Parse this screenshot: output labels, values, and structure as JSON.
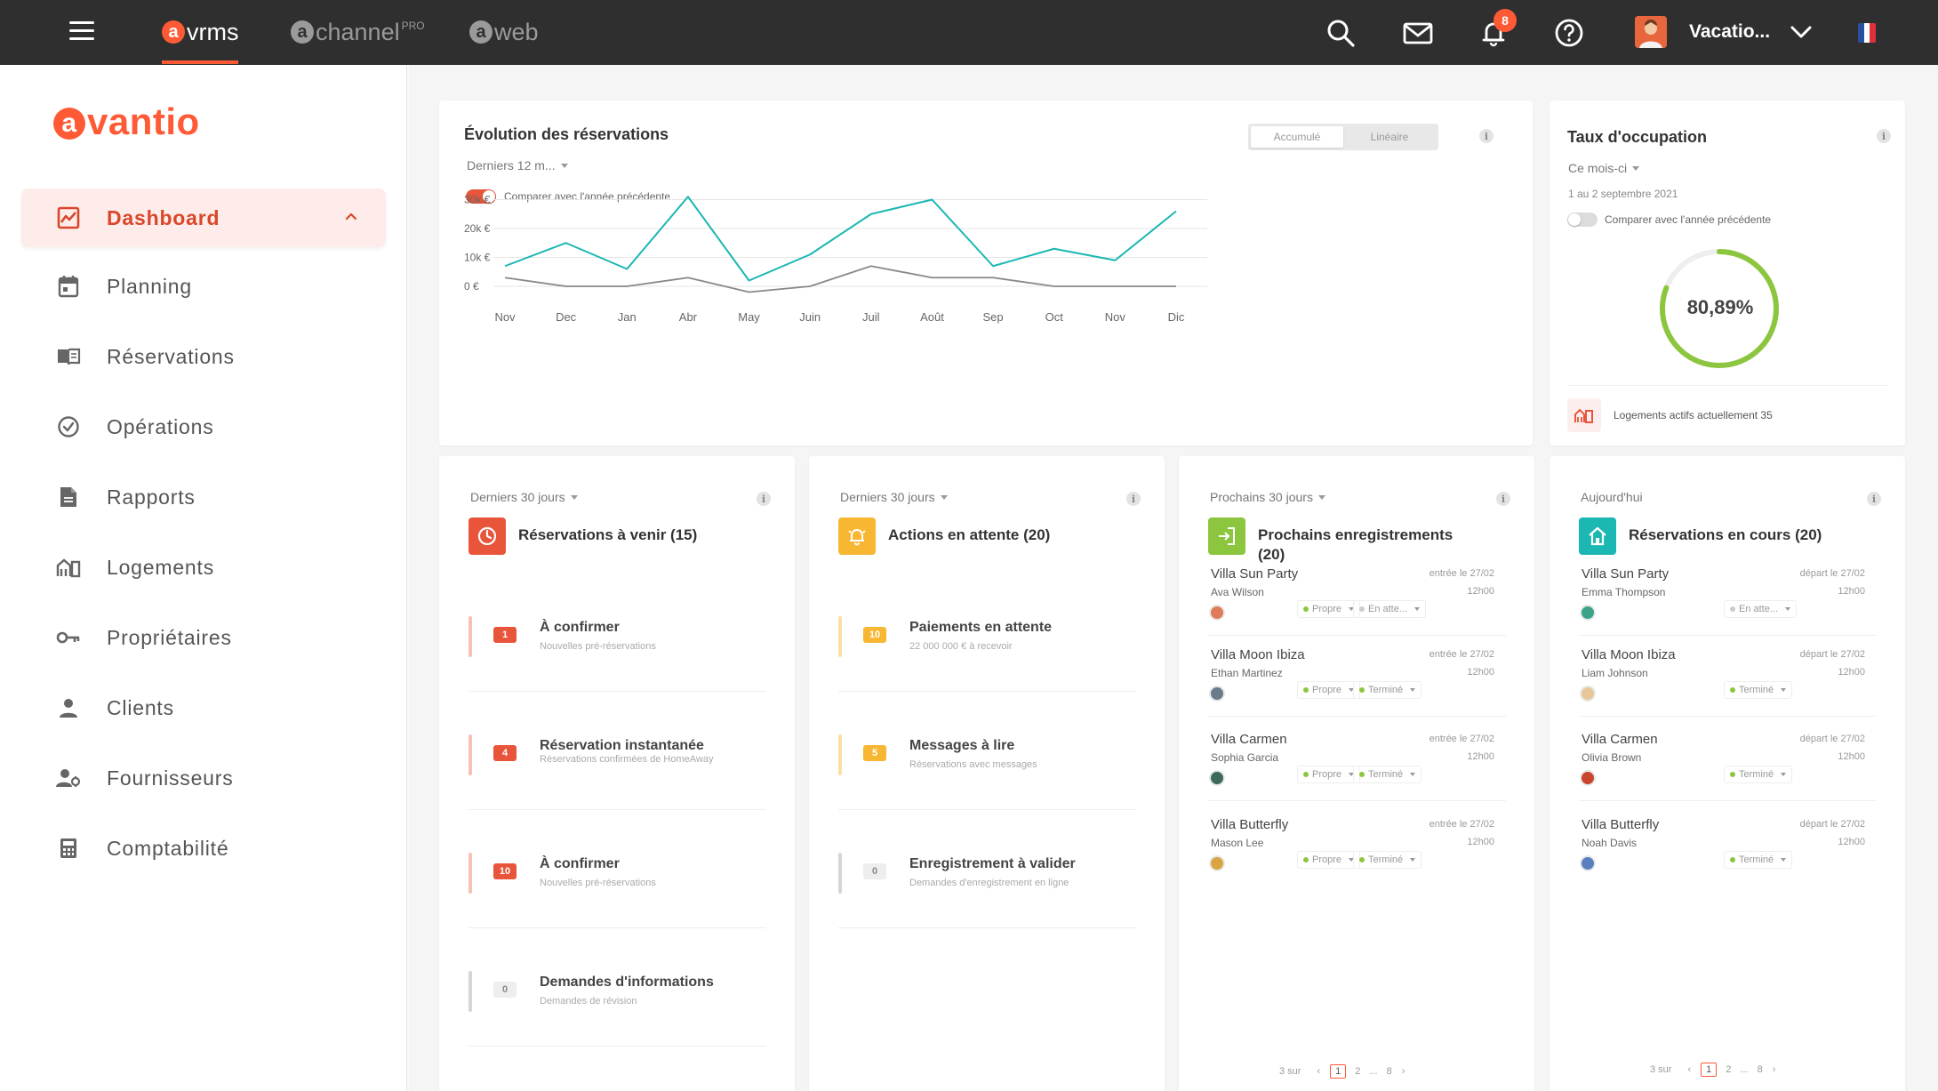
{
  "topbar": {
    "apps": [
      {
        "letter": "a",
        "name": "vrms",
        "sup": ""
      },
      {
        "letter": "a",
        "name": "channel",
        "sup": "PRO"
      },
      {
        "letter": "a",
        "name": "web",
        "sup": ""
      }
    ],
    "notifications_count": "8",
    "user_name": "Vacatio...",
    "icons": [
      "menu-icon",
      "search-icon",
      "mail-icon",
      "bell-icon",
      "help-icon",
      "chevron-down-icon",
      "flag-fr-icon"
    ]
  },
  "sidebar": {
    "brand_letter": "a",
    "brand_rest": "vantio",
    "items": [
      {
        "label": "Dashboard",
        "icon": "chart-icon"
      },
      {
        "label": "Planning",
        "icon": "calendar-icon"
      },
      {
        "label": "Réservations",
        "icon": "book-icon"
      },
      {
        "label": "Opérations",
        "icon": "check-circle-icon"
      },
      {
        "label": "Rapports",
        "icon": "document-icon"
      },
      {
        "label": "Logements",
        "icon": "buildings-icon"
      },
      {
        "label": "Propriétaires",
        "icon": "key-icon"
      },
      {
        "label": "Clients",
        "icon": "person-icon"
      },
      {
        "label": "Fournisseurs",
        "icon": "supplier-icon"
      },
      {
        "label": "Comptabilité",
        "icon": "calculator-icon"
      }
    ]
  },
  "evolution": {
    "title": "Évolution des réservations",
    "filter": "Derniers 12 m...",
    "compare_label": "Comparer avec l'année précédente",
    "seg_left": "Accumulé",
    "seg_right": "Linéaire"
  },
  "chart_data": {
    "type": "line",
    "categories": [
      "Nov",
      "Dec",
      "Jan",
      "Abr",
      "May",
      "Juin",
      "Juil",
      "Août",
      "Sep",
      "Oct",
      "Nov",
      "Dic"
    ],
    "y_ticks": [
      "30k €",
      "20k €",
      "10k €",
      "0 €"
    ],
    "ylim": [
      -4000,
      32000
    ],
    "series": [
      {
        "values": [
          7000,
          15000,
          6000,
          31000,
          2000,
          11000,
          25000,
          30000,
          7000,
          13000,
          9000,
          26000
        ],
        "color": "#1bb7b3"
      },
      {
        "values": [
          3000,
          0,
          0,
          3000,
          -2000,
          0,
          7000,
          3000,
          3000,
          0,
          0,
          0
        ],
        "color": "#888888"
      }
    ],
    "grid": true
  },
  "occupancy": {
    "title": "Taux d'occupation",
    "filter": "Ce mois-ci",
    "period": "1 au 2 septembre 2021",
    "compare_label": "Comparer avec l'année précédente",
    "value_text": "80,89%",
    "value_fraction": 0.8089,
    "gauge_color": "#8cc63f",
    "active_text": "Logements actifs actuellement 35"
  },
  "cards": [
    {
      "filter": "Derniers 30 jours",
      "title": "Réservations à venir (15)",
      "icon": "clock-icon",
      "color": "#e8553b",
      "rows": [
        {
          "count": "1",
          "title": "À confirmer",
          "sub": "Nouvelles pré-réservations",
          "color": "#e8553b",
          "bar": "#f6c2b8"
        },
        {
          "count": "4",
          "title": "Réservation instantanée",
          "sub": "Réservations confirmées de HomeAway",
          "color": "#e8553b",
          "bar": "#f6c2b8"
        },
        {
          "count": "10",
          "title": "À confirmer",
          "sub": "Nouvelles pré-réservations",
          "color": "#e8553b",
          "bar": "#f6c2b8"
        },
        {
          "count": "0",
          "title": "Demandes d'informations",
          "sub": "Demandes de révision",
          "color": "#e6e6e6",
          "bar": "#d6d6d6"
        }
      ]
    },
    {
      "filter": "Derniers 30 jours",
      "title": "Actions en attente (20)",
      "icon": "bell-icon",
      "color": "#f7b733",
      "rows": [
        {
          "count": "10",
          "title": "Paiements en attente",
          "sub": "22 000 000 € à recevoir",
          "color": "#f7b733",
          "bar": "#fbdfa5"
        },
        {
          "count": "5",
          "title": "Messages à lire",
          "sub": "Réservations avec messages",
          "color": "#f7b733",
          "bar": "#fbdfa5"
        },
        {
          "count": "0",
          "title": "Enregistrement à valider",
          "sub": "Demandes d'enregistrement en ligne",
          "color": "#e6e6e6",
          "bar": "#d6d6d6"
        }
      ]
    }
  ],
  "checkins": {
    "filter": "Prochains 30 jours",
    "title": "Prochains enregistrements (20)",
    "icon": "login-icon",
    "color": "#8cc63f",
    "items": [
      {
        "name": "Villa Sun Party",
        "guest": "Ava Wilson",
        "date": "entrée le 27/02",
        "time": "12h00",
        "chip1": "Propre",
        "chip2": "En atte...",
        "chip2_color": "#cccccc",
        "avatar": "#e07b5a"
      },
      {
        "name": "Villa Moon Ibiza",
        "guest": "Ethan Martinez",
        "date": "entrée le 27/02",
        "time": "12h00",
        "chip1": "Propre",
        "chip2": "Terminé",
        "chip2_color": "#8cc63f",
        "avatar": "#6b7b8c"
      },
      {
        "name": "Villa Carmen",
        "guest": "Sophia Garcia",
        "date": "entrée le 27/02",
        "time": "12h00",
        "chip1": "Propre",
        "chip2": "Terminé",
        "chip2_color": "#8cc63f",
        "avatar": "#3d6b5a"
      },
      {
        "name": "Villa Butterfly",
        "guest": "Mason Lee",
        "date": "entrée le 27/02",
        "time": "12h00",
        "chip1": "Propre",
        "chip2": "Terminé",
        "chip2_color": "#8cc63f",
        "avatar": "#d9a441"
      }
    ],
    "pager": {
      "label": "3 sur",
      "pages": [
        "1",
        "2",
        "...",
        "8"
      ]
    }
  },
  "inprogress": {
    "filter": "Aujourd'hui",
    "title": "Réservations en cours (20)",
    "icon": "home-icon",
    "color": "#1bb7b3",
    "items": [
      {
        "name": "Villa Sun Party",
        "guest": "Emma Thompson",
        "date": "départ le 27/02",
        "time": "12h00",
        "chip": "En atte...",
        "chip_color": "#cccccc",
        "avatar": "#3aa38a"
      },
      {
        "name": "Villa Moon Ibiza",
        "guest": "Liam Johnson",
        "date": "départ le 27/02",
        "time": "12h00",
        "chip": "Terminé",
        "chip_color": "#8cc63f",
        "avatar": "#e8c79a"
      },
      {
        "name": "Villa Carmen",
        "guest": "Olivia Brown",
        "date": "départ le 27/02",
        "time": "12h00",
        "chip": "Terminé",
        "chip_color": "#8cc63f",
        "avatar": "#c9462e"
      },
      {
        "name": "Villa Butterfly",
        "guest": "Noah Davis",
        "date": "départ le 27/02",
        "time": "12h00",
        "chip": "Terminé",
        "chip_color": "#8cc63f",
        "avatar": "#5a7fbf"
      }
    ],
    "pager": {
      "label": "3 sur",
      "pages": [
        "1",
        "2",
        "...",
        "8"
      ]
    }
  },
  "colors": {
    "accent": "#ff5a36",
    "topbar": "#2f2f2f",
    "teal": "#1bb7b3",
    "green": "#8cc63f",
    "amber": "#f7b733",
    "red": "#e8553b"
  }
}
